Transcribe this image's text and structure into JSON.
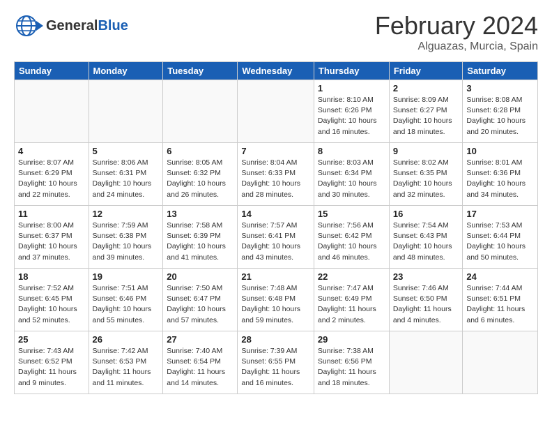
{
  "header": {
    "logo_general": "General",
    "logo_blue": "Blue",
    "month_title": "February 2024",
    "location": "Alguazas, Murcia, Spain"
  },
  "weekdays": [
    "Sunday",
    "Monday",
    "Tuesday",
    "Wednesday",
    "Thursday",
    "Friday",
    "Saturday"
  ],
  "weeks": [
    [
      {
        "day": "",
        "info": ""
      },
      {
        "day": "",
        "info": ""
      },
      {
        "day": "",
        "info": ""
      },
      {
        "day": "",
        "info": ""
      },
      {
        "day": "1",
        "info": "Sunrise: 8:10 AM\nSunset: 6:26 PM\nDaylight: 10 hours\nand 16 minutes."
      },
      {
        "day": "2",
        "info": "Sunrise: 8:09 AM\nSunset: 6:27 PM\nDaylight: 10 hours\nand 18 minutes."
      },
      {
        "day": "3",
        "info": "Sunrise: 8:08 AM\nSunset: 6:28 PM\nDaylight: 10 hours\nand 20 minutes."
      }
    ],
    [
      {
        "day": "4",
        "info": "Sunrise: 8:07 AM\nSunset: 6:29 PM\nDaylight: 10 hours\nand 22 minutes."
      },
      {
        "day": "5",
        "info": "Sunrise: 8:06 AM\nSunset: 6:31 PM\nDaylight: 10 hours\nand 24 minutes."
      },
      {
        "day": "6",
        "info": "Sunrise: 8:05 AM\nSunset: 6:32 PM\nDaylight: 10 hours\nand 26 minutes."
      },
      {
        "day": "7",
        "info": "Sunrise: 8:04 AM\nSunset: 6:33 PM\nDaylight: 10 hours\nand 28 minutes."
      },
      {
        "day": "8",
        "info": "Sunrise: 8:03 AM\nSunset: 6:34 PM\nDaylight: 10 hours\nand 30 minutes."
      },
      {
        "day": "9",
        "info": "Sunrise: 8:02 AM\nSunset: 6:35 PM\nDaylight: 10 hours\nand 32 minutes."
      },
      {
        "day": "10",
        "info": "Sunrise: 8:01 AM\nSunset: 6:36 PM\nDaylight: 10 hours\nand 34 minutes."
      }
    ],
    [
      {
        "day": "11",
        "info": "Sunrise: 8:00 AM\nSunset: 6:37 PM\nDaylight: 10 hours\nand 37 minutes."
      },
      {
        "day": "12",
        "info": "Sunrise: 7:59 AM\nSunset: 6:38 PM\nDaylight: 10 hours\nand 39 minutes."
      },
      {
        "day": "13",
        "info": "Sunrise: 7:58 AM\nSunset: 6:39 PM\nDaylight: 10 hours\nand 41 minutes."
      },
      {
        "day": "14",
        "info": "Sunrise: 7:57 AM\nSunset: 6:41 PM\nDaylight: 10 hours\nand 43 minutes."
      },
      {
        "day": "15",
        "info": "Sunrise: 7:56 AM\nSunset: 6:42 PM\nDaylight: 10 hours\nand 46 minutes."
      },
      {
        "day": "16",
        "info": "Sunrise: 7:54 AM\nSunset: 6:43 PM\nDaylight: 10 hours\nand 48 minutes."
      },
      {
        "day": "17",
        "info": "Sunrise: 7:53 AM\nSunset: 6:44 PM\nDaylight: 10 hours\nand 50 minutes."
      }
    ],
    [
      {
        "day": "18",
        "info": "Sunrise: 7:52 AM\nSunset: 6:45 PM\nDaylight: 10 hours\nand 52 minutes."
      },
      {
        "day": "19",
        "info": "Sunrise: 7:51 AM\nSunset: 6:46 PM\nDaylight: 10 hours\nand 55 minutes."
      },
      {
        "day": "20",
        "info": "Sunrise: 7:50 AM\nSunset: 6:47 PM\nDaylight: 10 hours\nand 57 minutes."
      },
      {
        "day": "21",
        "info": "Sunrise: 7:48 AM\nSunset: 6:48 PM\nDaylight: 10 hours\nand 59 minutes."
      },
      {
        "day": "22",
        "info": "Sunrise: 7:47 AM\nSunset: 6:49 PM\nDaylight: 11 hours\nand 2 minutes."
      },
      {
        "day": "23",
        "info": "Sunrise: 7:46 AM\nSunset: 6:50 PM\nDaylight: 11 hours\nand 4 minutes."
      },
      {
        "day": "24",
        "info": "Sunrise: 7:44 AM\nSunset: 6:51 PM\nDaylight: 11 hours\nand 6 minutes."
      }
    ],
    [
      {
        "day": "25",
        "info": "Sunrise: 7:43 AM\nSunset: 6:52 PM\nDaylight: 11 hours\nand 9 minutes."
      },
      {
        "day": "26",
        "info": "Sunrise: 7:42 AM\nSunset: 6:53 PM\nDaylight: 11 hours\nand 11 minutes."
      },
      {
        "day": "27",
        "info": "Sunrise: 7:40 AM\nSunset: 6:54 PM\nDaylight: 11 hours\nand 14 minutes."
      },
      {
        "day": "28",
        "info": "Sunrise: 7:39 AM\nSunset: 6:55 PM\nDaylight: 11 hours\nand 16 minutes."
      },
      {
        "day": "29",
        "info": "Sunrise: 7:38 AM\nSunset: 6:56 PM\nDaylight: 11 hours\nand 18 minutes."
      },
      {
        "day": "",
        "info": ""
      },
      {
        "day": "",
        "info": ""
      }
    ]
  ]
}
